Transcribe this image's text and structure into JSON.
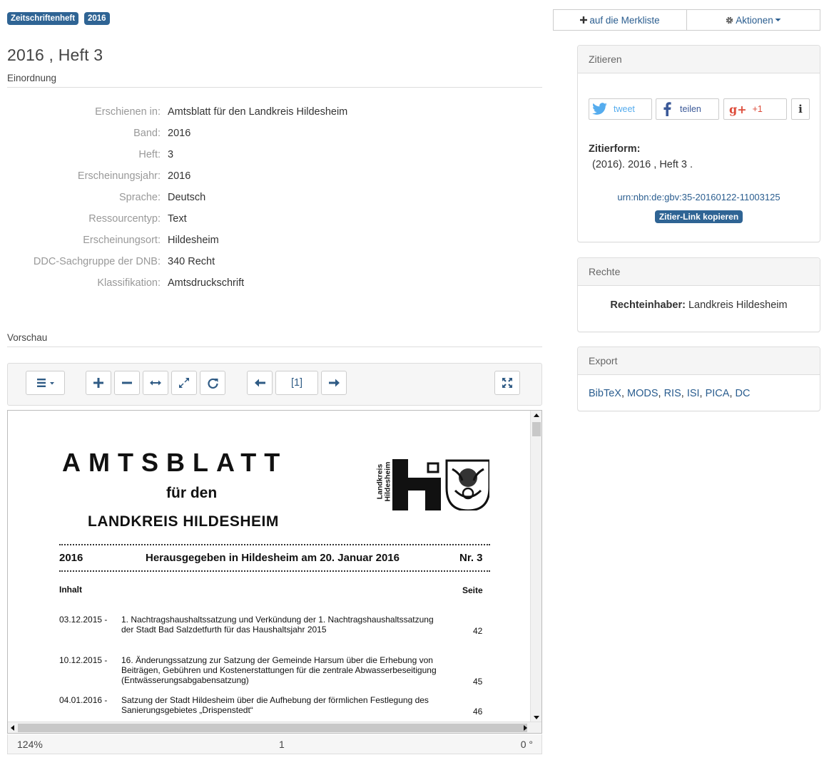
{
  "badges": [
    "Zeitschriftenheft",
    "2016"
  ],
  "title": "2016 , Heft 3",
  "sections": {
    "einordnung": "Einordnung",
    "vorschau": "Vorschau"
  },
  "metadata": [
    {
      "key": "Erschienen in:",
      "value": "Amtsblatt für den Landkreis Hildesheim",
      "link": true
    },
    {
      "key": "Band:",
      "value": "2016"
    },
    {
      "key": "Heft:",
      "value": "3"
    },
    {
      "key": "Erscheinungsjahr:",
      "value": "2016"
    },
    {
      "key": "Sprache:",
      "value": "Deutsch"
    },
    {
      "key": "Ressourcentyp:",
      "value": "Text"
    },
    {
      "key": "Erscheinungsort:",
      "value": "Hildesheim"
    },
    {
      "key": "DDC-Sachgruppe der DNB:",
      "value": "340 Recht"
    },
    {
      "key": "Klassifikation:",
      "value": "Amtsdruckschrift"
    }
  ],
  "viewer": {
    "page_field": "[1]",
    "status": {
      "zoom": "124%",
      "page": "1",
      "rotation": "0 °"
    }
  },
  "document": {
    "masthead": "AMTSBLATT",
    "subtitle": "für den",
    "district": "LANDKREIS HILDESHEIM",
    "logo_text_1": "Landkreis",
    "logo_text_2": "Hildesheim",
    "year": "2016",
    "issued": "Herausgegeben in Hildesheim am 20. Januar 2016",
    "number": "Nr. 3",
    "inhalt": "Inhalt",
    "seite": "Seite",
    "entries": [
      {
        "date": "03.12.2015  -",
        "lines": [
          "1. Nachtragshaushaltssatzung und Verkündung der 1. Nachtragshaushaltssatzung",
          "der Stadt Bad Salzdetfurth für das Haushaltsjahr 2015"
        ],
        "page": "42"
      },
      {
        "date": "10.12.2015  -",
        "lines": [
          "16. Änderungssatzung zur Satzung der Gemeinde Harsum über die Erhebung von",
          "Beiträgen, Gebühren und Kostenerstattungen für die zentrale Abwasserbeseitigung",
          "(Entwässerungsabgabensatzung)"
        ],
        "page": "45"
      },
      {
        "date": "04.01.2016  -",
        "lines": [
          "Satzung der Stadt Hildesheim über die Aufhebung der förmlichen Festlegung des",
          "Sanierungsgebietes „Drispenstedt“"
        ],
        "page": "46"
      }
    ]
  },
  "actions": {
    "merkliste": "auf die Merkliste",
    "aktionen": "Aktionen"
  },
  "zitieren": {
    "heading": "Zitieren",
    "tweet": "tweet",
    "teilen": "teilen",
    "plusone": "+1",
    "info": "i",
    "zitierform_label": "Zitierform:",
    "zitierform": "(2016). 2016 , Heft 3 .",
    "urn": "urn:nbn:de:gbv:35-20160122-11003125",
    "copy_link": "Zitier-Link kopieren"
  },
  "rechte": {
    "heading": "Rechte",
    "label": "Rechteinhaber:",
    "value": "Landkreis Hildesheim"
  },
  "export": {
    "heading": "Export",
    "formats": [
      "BibTeX",
      "MODS",
      "RIS",
      "ISI",
      "PICA",
      "DC"
    ]
  },
  "colors": {
    "badge": "#2f6494",
    "link": "#2a5d8f",
    "twitter": "#55acee",
    "facebook": "#3b5998",
    "gplus": "#dd4b39"
  }
}
